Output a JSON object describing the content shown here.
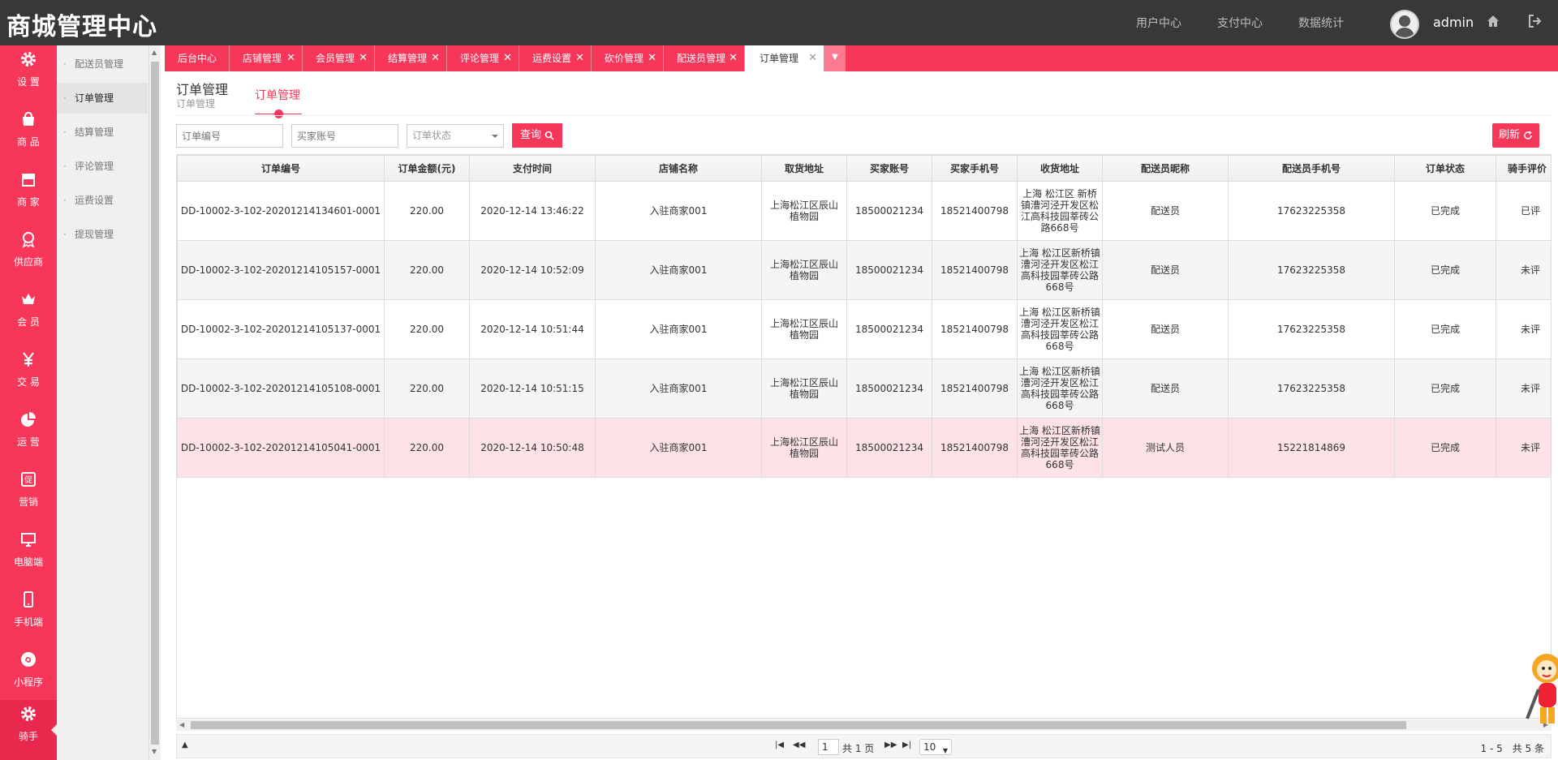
{
  "header": {
    "brand": "商城管理中心",
    "nav": [
      "用户中心",
      "支付中心",
      "数据统计"
    ],
    "username": "admin"
  },
  "sidebar": {
    "items": [
      {
        "label": "设 置",
        "icon": "gear-icon"
      },
      {
        "label": "商 品",
        "icon": "shopping-bag-icon"
      },
      {
        "label": "商 家",
        "icon": "store-icon"
      },
      {
        "label": "供应商",
        "icon": "award-icon"
      },
      {
        "label": "会 员",
        "icon": "crown-icon"
      },
      {
        "label": "交 易",
        "icon": "yuan-icon"
      },
      {
        "label": "运 营",
        "icon": "pie-chart-icon"
      },
      {
        "label": "营销",
        "icon": "promo-icon"
      },
      {
        "label": "电脑端",
        "icon": "monitor-icon"
      },
      {
        "label": "手机端",
        "icon": "mobile-icon"
      },
      {
        "label": "小程序",
        "icon": "mini-program-icon"
      },
      {
        "label": "骑手",
        "icon": "gear-icon",
        "active": true
      }
    ]
  },
  "submenu": {
    "items": [
      "配送员管理",
      "订单管理",
      "结算管理",
      "评论管理",
      "运费设置",
      "提现管理"
    ],
    "active_index": 1
  },
  "tabs": [
    "后台中心",
    "店铺管理",
    "会员管理",
    "结算管理",
    "评论管理",
    "运费设置",
    "砍价管理",
    "配送员管理",
    "订单管理"
  ],
  "page": {
    "title": "订单管理",
    "subtitle": "订单管理",
    "section_tab": "订单管理"
  },
  "filters": {
    "order_no_placeholder": "订单编号",
    "buyer_placeholder": "买家账号",
    "status_placeholder": "订单状态",
    "search_label": "查询",
    "refresh_label": "刷新"
  },
  "table": {
    "columns": [
      "订单编号",
      "订单金额(元)",
      "支付时间",
      "店铺名称",
      "取货地址",
      "买家账号",
      "买家手机号",
      "收货地址",
      "配送员昵称",
      "配送员手机号",
      "订单状态",
      "骑手评价"
    ],
    "rows": [
      [
        "DD-10002-3-102-20201214134601-0001",
        "220.00",
        "2020-12-14 13:46:22",
        "入驻商家001",
        "上海松江区辰山植物园",
        "18500021234",
        "18521400798",
        "上海 松江区 新桥镇漕河泾开发区松江高科技园莘砖公路668号",
        "配送员",
        "17623225358",
        "已完成",
        "已评"
      ],
      [
        "DD-10002-3-102-20201214105157-0001",
        "220.00",
        "2020-12-14 10:52:09",
        "入驻商家001",
        "上海松江区辰山植物园",
        "18500021234",
        "18521400798",
        "上海 松江区新桥镇漕河泾开发区松江高科技园莘砖公路668号",
        "配送员",
        "17623225358",
        "已完成",
        "未评"
      ],
      [
        "DD-10002-3-102-20201214105137-0001",
        "220.00",
        "2020-12-14 10:51:44",
        "入驻商家001",
        "上海松江区辰山植物园",
        "18500021234",
        "18521400798",
        "上海 松江区新桥镇漕河泾开发区松江高科技园莘砖公路668号",
        "配送员",
        "17623225358",
        "已完成",
        "未评"
      ],
      [
        "DD-10002-3-102-20201214105108-0001",
        "220.00",
        "2020-12-14 10:51:15",
        "入驻商家001",
        "上海松江区辰山植物园",
        "18500021234",
        "18521400798",
        "上海 松江区新桥镇漕河泾开发区松江高科技园莘砖公路668号",
        "配送员",
        "17623225358",
        "已完成",
        "未评"
      ],
      [
        "DD-10002-3-102-20201214105041-0001",
        "220.00",
        "2020-12-14 10:50:48",
        "入驻商家001",
        "上海松江区辰山植物园",
        "18500021234",
        "18521400798",
        "上海 松江区新桥镇漕河泾开发区松江高科技园莘砖公路668号",
        "测试人员",
        "15221814869",
        "已完成",
        "未评"
      ]
    ],
    "selected_row": 4
  },
  "pager": {
    "page_value": "1",
    "total_pages": "共 1 页",
    "page_size": "10",
    "summary": "1 - 5　共 5 条"
  },
  "colors": {
    "accent": "#f7375a",
    "header_bg": "#383838"
  }
}
